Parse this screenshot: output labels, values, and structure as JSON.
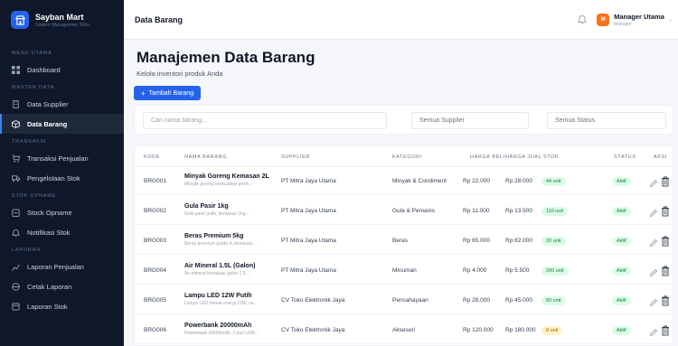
{
  "brand": {
    "name": "Sayban Mart",
    "subtitle": "Sistem Manajemen Toko"
  },
  "sidebar": {
    "sections": [
      {
        "label": "MENU UTAMA",
        "items": [
          {
            "label": "Dashboard",
            "icon": "dashboard-icon"
          }
        ]
      },
      {
        "label": "MASTER DATA",
        "items": [
          {
            "label": "Data Supplier",
            "icon": "building-icon"
          },
          {
            "label": "Data Barang",
            "icon": "box-icon",
            "active": true
          }
        ]
      },
      {
        "label": "TRANSAKSI",
        "items": [
          {
            "label": "Transaksi Penjualan",
            "icon": "cart-icon"
          },
          {
            "label": "Pengelolaan Stok",
            "icon": "truck-icon"
          }
        ]
      },
      {
        "label": "STOK OPNAME",
        "items": [
          {
            "label": "Stock Opname",
            "icon": "clipboard-icon"
          },
          {
            "label": "Notifikasi Stok",
            "icon": "bell-icon"
          }
        ]
      },
      {
        "label": "LAPORAN",
        "items": [
          {
            "label": "Laporan Penjualan",
            "icon": "chart-icon"
          },
          {
            "label": "Cetak Laporan",
            "icon": "printer-icon"
          },
          {
            "label": "Laporan Stok",
            "icon": "report-icon"
          }
        ]
      }
    ]
  },
  "topbar": {
    "title": "Data Barang",
    "user": {
      "initial": "M",
      "name": "Manager Utama",
      "role": "Manager"
    }
  },
  "page": {
    "title": "Manajemen Data Barang",
    "subtitle": "Kelola inventori produk Anda",
    "add_button": "Tambah Barang",
    "search_placeholder": "Cari nama barang...",
    "supplier_filter": "Semua Supplier",
    "status_filter": "Semua Status"
  },
  "table": {
    "headers": [
      "KODE",
      "NAMA BARANG",
      "SUPPLIER",
      "KATEGORI",
      "HARGA BELI",
      "HARGA JUAL",
      "STOK",
      "STATUS",
      "AKSI"
    ],
    "rows": [
      {
        "kode": "BRG001",
        "nama": "Minyak Goreng Kemasan 2L",
        "desc": "Minyak goreng berkualitas prem...",
        "supplier": "PT Mitra Jaya Utama",
        "kategori": "Minyak & Condiment",
        "beli": "Rp 22.000",
        "jual": "Rp 28.000",
        "stok": "44 unit",
        "stok_level": "ok",
        "status": "Aktif"
      },
      {
        "kode": "BRG002",
        "nama": "Gula Pasir 1kg",
        "desc": "Gula pasir putih, kemasan 1kg...",
        "supplier": "PT Mitra Jaya Utama",
        "kategori": "Gula & Pemanis",
        "beli": "Rp 11.000",
        "jual": "Rp 13.500",
        "stok": "110 unit",
        "stok_level": "ok",
        "status": "Aktif"
      },
      {
        "kode": "BRG003",
        "nama": "Beras Premium 5kg",
        "desc": "Beras premium grade A, kemasan...",
        "supplier": "PT Mitra Jaya Utama",
        "kategori": "Beras",
        "beli": "Rp 65.000",
        "jual": "Rp 82.000",
        "stok": "20 unit",
        "stok_level": "ok",
        "status": "Aktif"
      },
      {
        "kode": "BRG004",
        "nama": "Air Mineral 1.5L (Galon)",
        "desc": "Air mineral kemasan galon 1.5 ...",
        "supplier": "PT Mitra Jaya Utama",
        "kategori": "Minuman",
        "beli": "Rp 4.000",
        "jual": "Rp 5.500",
        "stok": "200 unit",
        "stok_level": "ok",
        "status": "Aktif"
      },
      {
        "kode": "BRG005",
        "nama": "Lampu LED 12W Putih",
        "desc": "Lampu LED hemat energi 12W, ca...",
        "supplier": "CV Toko Elektronik Jaya",
        "kategori": "Pencahayaan",
        "beli": "Rp 28.000",
        "jual": "Rp 45.000",
        "stok": "60 unit",
        "stok_level": "ok",
        "status": "Aktif"
      },
      {
        "kode": "BRG006",
        "nama": "Powerbank 20000mAh",
        "desc": "Powerbank 20000mAh, 2 port USB...",
        "supplier": "CV Toko Elektronik Jaya",
        "kategori": "Aksesori",
        "beli": "Rp 120.000",
        "jual": "Rp 180.000",
        "stok": "8 unit",
        "stok_level": "low",
        "status": "Aktif"
      }
    ]
  },
  "colors": {
    "sidebar_bg": "#0f172a",
    "accent": "#2563eb",
    "avatar": "#f97316",
    "badge_green": "#dcfce7",
    "badge_yellow": "#fef3c7"
  }
}
